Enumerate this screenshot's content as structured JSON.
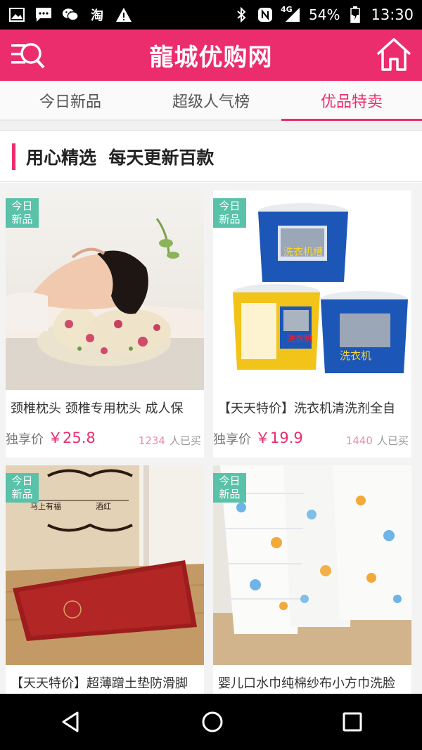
{
  "status_bar": {
    "battery": "54%",
    "time": "13:30",
    "network": "4G",
    "icons": [
      "image-icon",
      "message-icon",
      "wechat-icon",
      "taobao-icon",
      "warning-icon",
      "bluetooth-icon",
      "nfc-icon",
      "signal-icon",
      "battery-icon"
    ],
    "taobao_glyph": "淘"
  },
  "header": {
    "title": "龍城优购网",
    "left_icon": "menu-search-icon",
    "right_icon": "home-icon",
    "color": "#ec2d6d"
  },
  "tabs": [
    {
      "label": "今日新品",
      "active": false
    },
    {
      "label": "超级人气榜",
      "active": false
    },
    {
      "label": "优品特卖",
      "active": true
    }
  ],
  "section": {
    "title": "用心精选  每天更新百款"
  },
  "products": [
    {
      "badge": [
        "今日",
        "新品"
      ],
      "name": "颈椎枕头 颈椎专用枕头 成人保",
      "price_label": "独享价",
      "price": "￥25.8",
      "sold_count": "1234",
      "sold_suffix": "人已买"
    },
    {
      "badge": [
        "今日",
        "新品"
      ],
      "name": "【天天特价】洗衣机清洗剂全自",
      "price_label": "独享价",
      "price": "￥19.9",
      "sold_count": "1440",
      "sold_suffix": "人已买"
    },
    {
      "badge": [
        "今日",
        "新品"
      ],
      "name": "【天天特价】超薄蹭土垫防滑脚",
      "image_text": [
        "马上有福",
        "酒红"
      ]
    },
    {
      "badge": [
        "今日",
        "新品"
      ],
      "name": "婴儿口水巾纯棉纱布小方巾洗脸"
    }
  ],
  "nav_bar": {
    "icons": [
      "back-icon",
      "home-circle-icon",
      "recents-icon"
    ]
  }
}
